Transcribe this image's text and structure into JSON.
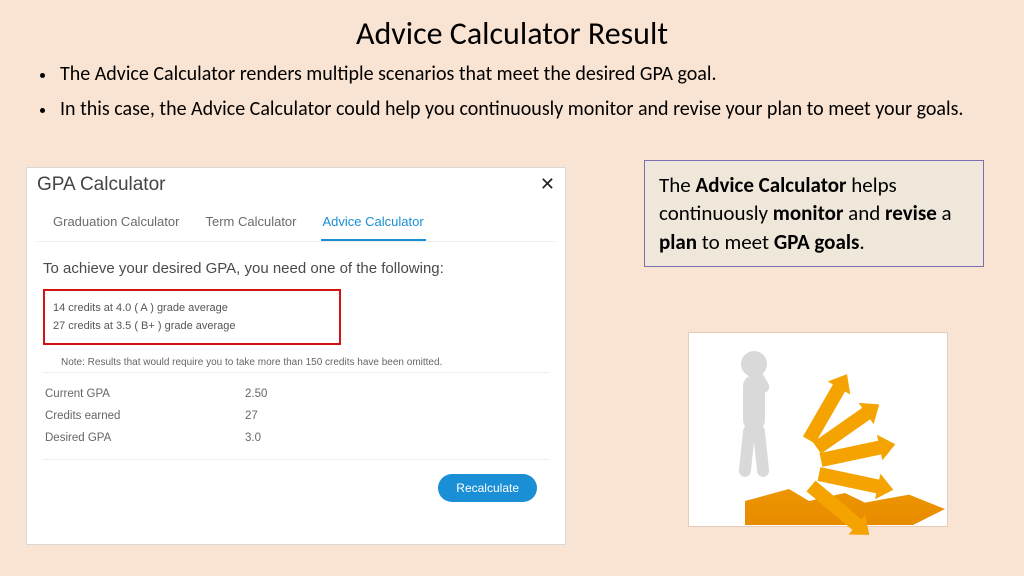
{
  "title": "Advice Calculator Result",
  "bullets": [
    "The Advice Calculator renders multiple scenarios that meet the desired GPA goal.",
    "In this case, the Advice Calculator could help you continuously monitor and revise your plan to meet your goals."
  ],
  "panel": {
    "header": "GPA Calculator",
    "close": "✕",
    "tabs": [
      "Graduation Calculator",
      "Term Calculator",
      "Advice Calculator"
    ],
    "achieve": "To achieve your desired GPA, you need one of the following:",
    "scenarios": [
      "14 credits at 4.0 ( A ) grade average",
      "27 credits at 3.5 ( B+ ) grade average"
    ],
    "note": "Note: Results that would require you to take more than 150 credits have been omitted.",
    "rows": [
      {
        "label": "Current GPA",
        "value": "2.50"
      },
      {
        "label": "Credits earned",
        "value": "27"
      },
      {
        "label": "Desired GPA",
        "value": "3.0"
      }
    ],
    "button": "Recalculate"
  },
  "callout": {
    "p1a": "The ",
    "p1b": "Advice Calculator",
    "p2": " helps continuously ",
    "p3": "monitor",
    "p4": " and ",
    "p5": "revise",
    "p6": " a ",
    "p7": "plan",
    "p8": " to meet ",
    "p9": "GPA goals",
    "p10": "."
  }
}
